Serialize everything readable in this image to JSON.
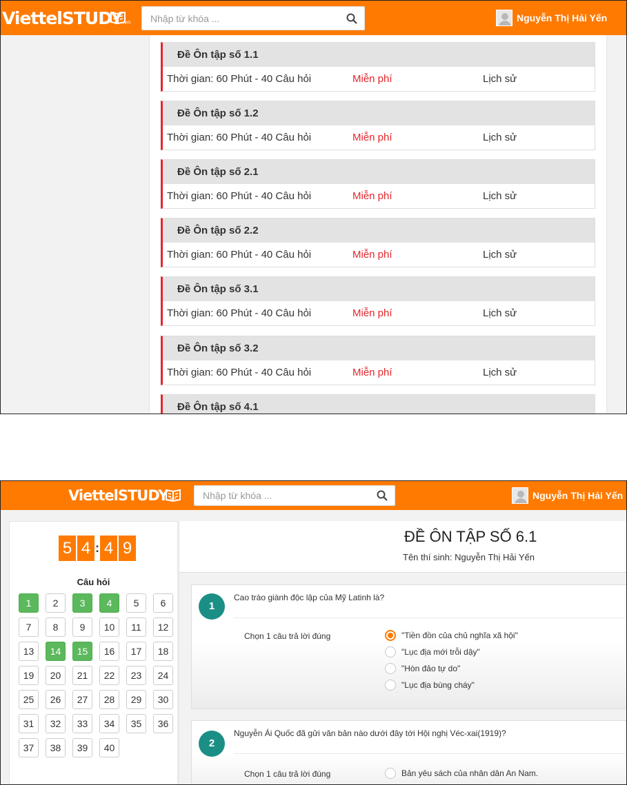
{
  "brand": {
    "logo_text": "ViettelSTUDY",
    "logo_suffix": ".vn",
    "accent": "#ff7a00",
    "icon": "book-icon"
  },
  "search": {
    "placeholder": "Nhập từ khóa ...",
    "icon": "search-icon"
  },
  "user": {
    "name": "Nguyễn Thị Hải Yến",
    "icon": "avatar"
  },
  "exam_list": [
    {
      "title": "Đề Ôn tập số 1.1",
      "time": "Thời gian: 60 Phút - 40 Câu hỏi",
      "price": "Miễn phí",
      "history": "Lịch sử"
    },
    {
      "title": "Đề Ôn tập số 1.2",
      "time": "Thời gian: 60 Phút - 40 Câu hỏi",
      "price": "Miễn phí",
      "history": "Lịch sử"
    },
    {
      "title": "Đề Ôn tập số 2.1",
      "time": "Thời gian: 60 Phút - 40 Câu hỏi",
      "price": "Miễn phí",
      "history": "Lịch sử"
    },
    {
      "title": "Đề Ôn tập số 2.2",
      "time": "Thời gian: 60 Phút - 40 Câu hỏi",
      "price": "Miễn phí",
      "history": "Lịch sử"
    },
    {
      "title": "Đề Ôn tập số 3.1",
      "time": "Thời gian: 60 Phút - 40 Câu hỏi",
      "price": "Miễn phí",
      "history": "Lịch sử"
    },
    {
      "title": "Đề Ôn tập số 3.2",
      "time": "Thời gian: 60 Phút - 40 Câu hỏi",
      "price": "Miễn phí",
      "history": "Lịch sử"
    },
    {
      "title": "Đề Ôn tập số 4.1"
    }
  ],
  "exam": {
    "timer_digits": [
      "5",
      "4",
      "4",
      "9"
    ],
    "timer_separator": ":",
    "questions_label": "Câu hỏi",
    "answered": [
      1,
      3,
      4,
      14,
      15
    ],
    "question_count": 40,
    "title": "ĐỀ ÔN TẬP SỐ 6.1",
    "candidate": "Tên thí sinh: Nguyễn Thị Hải Yến",
    "questions": [
      {
        "number": "1",
        "text": "Cao trào giành độc lập của Mỹ Latinh là?",
        "instruction": "Chọn 1 câu trả lời đúng",
        "options": [
          "\"Tiền đồn của chủ nghĩa xã hội\"",
          "\"Lục địa mới trỗi dậy\"",
          "\"Hòn đảo tự do\"",
          "\"Lục địa bùng cháy\""
        ],
        "selected": 0
      },
      {
        "number": "2",
        "text": "Nguyễn Ái Quốc đã gửi văn bản nào dưới đây tới Hội nghị Véc-xai(1919)?",
        "instruction": "Chọn 1 câu trả lời đúng",
        "options": [
          "Bản yêu sách của nhân dân An Nam."
        ],
        "selected": -1
      }
    ]
  }
}
